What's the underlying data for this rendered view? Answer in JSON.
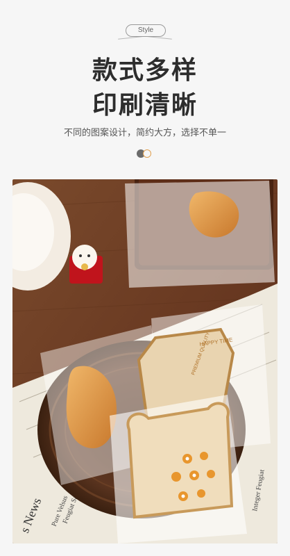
{
  "header": {
    "tag_label": "Style",
    "title_line1": "款式多样",
    "title_line2": "印刷清晰",
    "subtitle": "不同的图案设计，简约大方，选择不单一"
  },
  "photo": {
    "bag_print_1": "HAPPY TIME",
    "bag_print_2": "PREMIUM QUALITY",
    "newspaper_text_1": "Integer Feugiat",
    "newspaper_text_2": "Feugiat Sat",
    "newspaper_text_3": "Pure Velsus",
    "newspaper_text_4": "s News"
  },
  "colors": {
    "accent": "#e0a050",
    "title": "#2d2d2d",
    "table": "#6a3a22"
  }
}
